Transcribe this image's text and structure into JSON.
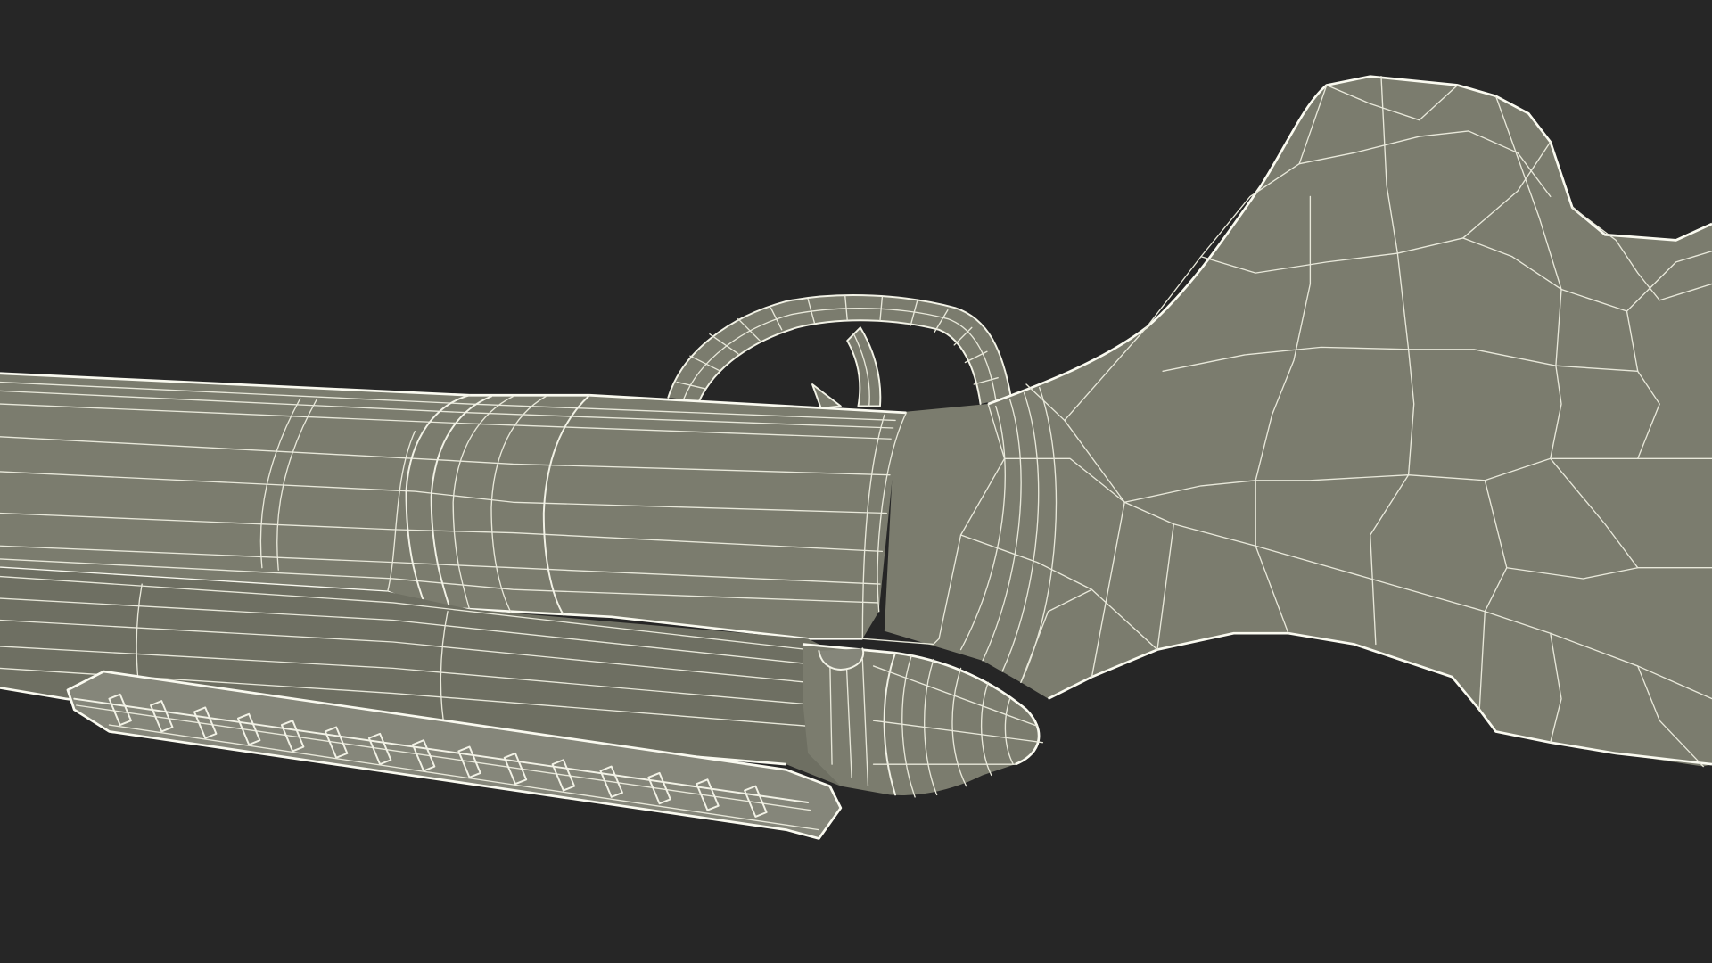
{
  "scene": {
    "background_color": "#262626",
    "mesh_color": "#7b7c6e",
    "wire_color": "#f2f2e6"
  }
}
